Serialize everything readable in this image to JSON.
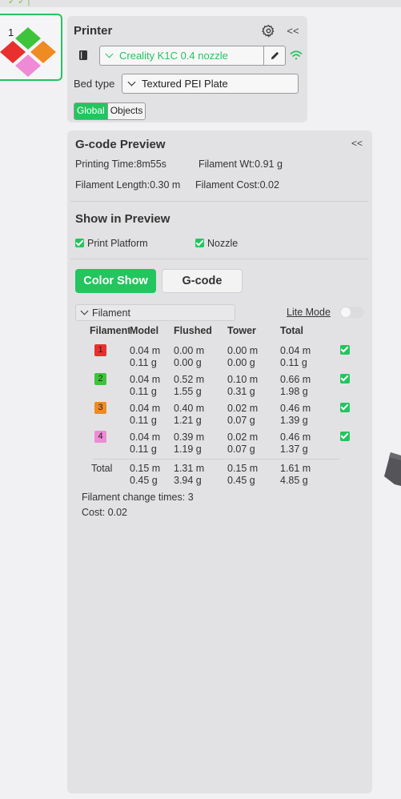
{
  "plate": {
    "number": "1"
  },
  "printer": {
    "title": "Printer",
    "name": "Creality K1C 0.4 nozzle",
    "bed_type_label": "Bed type",
    "bed_type_value": "Textured PEI Plate",
    "tabs": [
      "Global",
      "Objects"
    ],
    "collapse_label": "<<"
  },
  "preview": {
    "title": "G-code Preview",
    "collapse_label": "<<",
    "printing_time": "Printing Time:8m55s",
    "filament_wt": "Filament Wt:0.91 g",
    "filament_length": "Filament Length:0.30 m",
    "filament_cost": "Filament Cost:0.02",
    "show_title": "Show in Preview",
    "print_platform": "Print Platform",
    "nozzle": "Nozzle",
    "color_show": "Color Show",
    "gcode": "G-code",
    "filament_dropdown": "Filament",
    "lite_mode": "Lite Mode",
    "columns": [
      "Filament",
      "Model",
      "Flushed",
      "Tower",
      "Total"
    ],
    "rows": [
      {
        "id": "1",
        "color": "#e8302e",
        "model": [
          "0.04 m",
          "0.11 g"
        ],
        "flushed": [
          "0.00 m",
          "0.00 g"
        ],
        "tower": [
          "0.00 m",
          "0.00 g"
        ],
        "total": [
          "0.04 m",
          "0.11 g"
        ]
      },
      {
        "id": "2",
        "color": "#3ec43b",
        "model": [
          "0.04 m",
          "0.11 g"
        ],
        "flushed": [
          "0.52 m",
          "1.55 g"
        ],
        "tower": [
          "0.10 m",
          "0.31 g"
        ],
        "total": [
          "0.66 m",
          "1.98 g"
        ]
      },
      {
        "id": "3",
        "color": "#f08a22",
        "model": [
          "0.04 m",
          "0.11 g"
        ],
        "flushed": [
          "0.40 m",
          "1.21 g"
        ],
        "tower": [
          "0.02 m",
          "0.07 g"
        ],
        "total": [
          "0.46 m",
          "1.39 g"
        ]
      },
      {
        "id": "4",
        "color": "#ee8ad6",
        "model": [
          "0.04 m",
          "0.11 g"
        ],
        "flushed": [
          "0.39 m",
          "1.19 g"
        ],
        "tower": [
          "0.02 m",
          "0.07 g"
        ],
        "total": [
          "0.46 m",
          "1.37 g"
        ]
      }
    ],
    "total": {
      "label": "Total",
      "model": [
        "0.15 m",
        "0.45 g"
      ],
      "flushed": [
        "1.31 m",
        "3.94 g"
      ],
      "tower": [
        "0.15 m",
        "0.45 g"
      ],
      "total": [
        "1.61 m",
        "4.85 g"
      ]
    },
    "change_times": "Filament change times:  3",
    "cost": "Cost:  0.02"
  },
  "colors": {
    "accent": "#22c55e",
    "panel": "#e2e2e4",
    "background": "#f1f1f4"
  }
}
